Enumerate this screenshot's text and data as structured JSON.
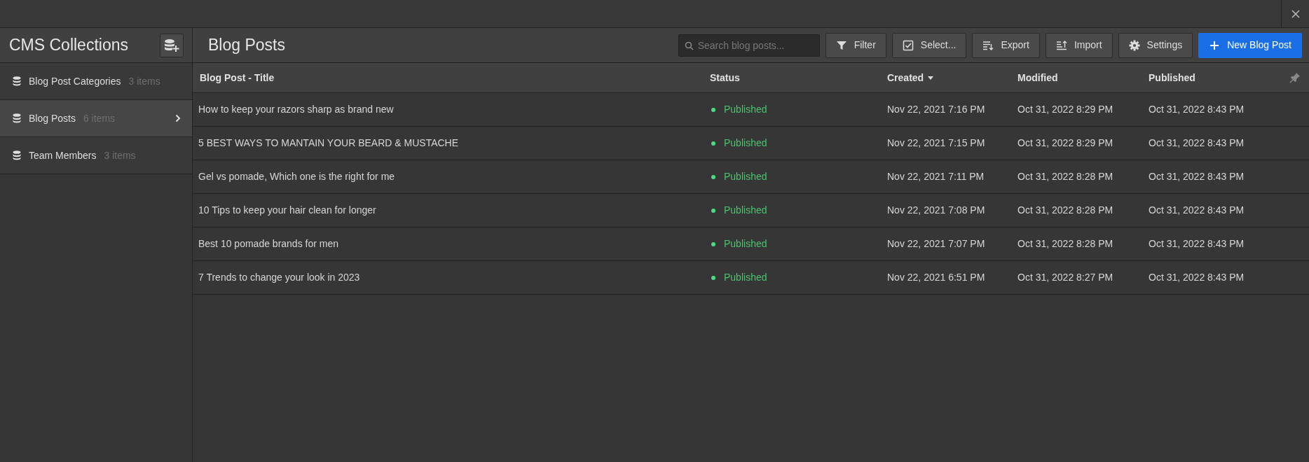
{
  "sidebar": {
    "title": "CMS Collections",
    "items": [
      {
        "label": "Blog Post Categories",
        "count": "3 items",
        "selected": false
      },
      {
        "label": "Blog Posts",
        "count": "6 items",
        "selected": true
      },
      {
        "label": "Team Members",
        "count": "3 items",
        "selected": false
      }
    ]
  },
  "main": {
    "title": "Blog Posts",
    "search": {
      "placeholder": "Search blog posts..."
    },
    "buttons": [
      {
        "label": "Filter",
        "kind": "filter"
      },
      {
        "label": "Select...",
        "kind": "select"
      },
      {
        "label": "Export",
        "kind": "export"
      },
      {
        "label": "Import",
        "kind": "import"
      },
      {
        "label": "Settings",
        "kind": "settings"
      },
      {
        "label": "New Blog Post",
        "kind": "new"
      }
    ]
  },
  "table": {
    "columns": [
      {
        "label": "Blog Post - Title",
        "sorted": false
      },
      {
        "label": "Status",
        "sorted": false
      },
      {
        "label": "Created",
        "sorted": true
      },
      {
        "label": "Modified",
        "sorted": false
      },
      {
        "label": "Published",
        "sorted": false
      }
    ],
    "rows": [
      {
        "title": "How to keep your razors sharp as brand new",
        "status": "Published",
        "color": "#4ade80",
        "created": "Nov 22, 2021 7:16 PM",
        "modified": "Oct 31, 2022 8:29 PM",
        "published": "Oct 31, 2022 8:43 PM"
      },
      {
        "title": "5 BEST WAYS TO MANTAIN YOUR BEARD & MUSTACHE",
        "status": "Published",
        "color": "#4ade80",
        "created": "Nov 22, 2021 7:15 PM",
        "modified": "Oct 31, 2022 8:29 PM",
        "published": "Oct 31, 2022 8:43 PM"
      },
      {
        "title": "Gel vs pomade, Which one is the right for me",
        "status": "Published",
        "color": "#4ade80",
        "created": "Nov 22, 2021 7:11 PM",
        "modified": "Oct 31, 2022 8:28 PM",
        "published": "Oct 31, 2022 8:43 PM"
      },
      {
        "title": "10 Tips to keep your hair clean for longer",
        "status": "Published",
        "color": "#4ade80",
        "created": "Nov 22, 2021 7:08 PM",
        "modified": "Oct 31, 2022 8:28 PM",
        "published": "Oct 31, 2022 8:43 PM"
      },
      {
        "title": "Best 10 pomade brands for men",
        "status": "Published",
        "color": "#4ade80",
        "created": "Nov 22, 2021 7:07 PM",
        "modified": "Oct 31, 2022 8:28 PM",
        "published": "Oct 31, 2022 8:43 PM"
      },
      {
        "title": "7 Trends to change your look in 2023",
        "status": "Published",
        "color": "#4ade80",
        "created": "Nov 22, 2021 6:51 PM",
        "modified": "Oct 31, 2022 8:27 PM",
        "published": "Oct 31, 2022 8:43 PM"
      }
    ]
  }
}
